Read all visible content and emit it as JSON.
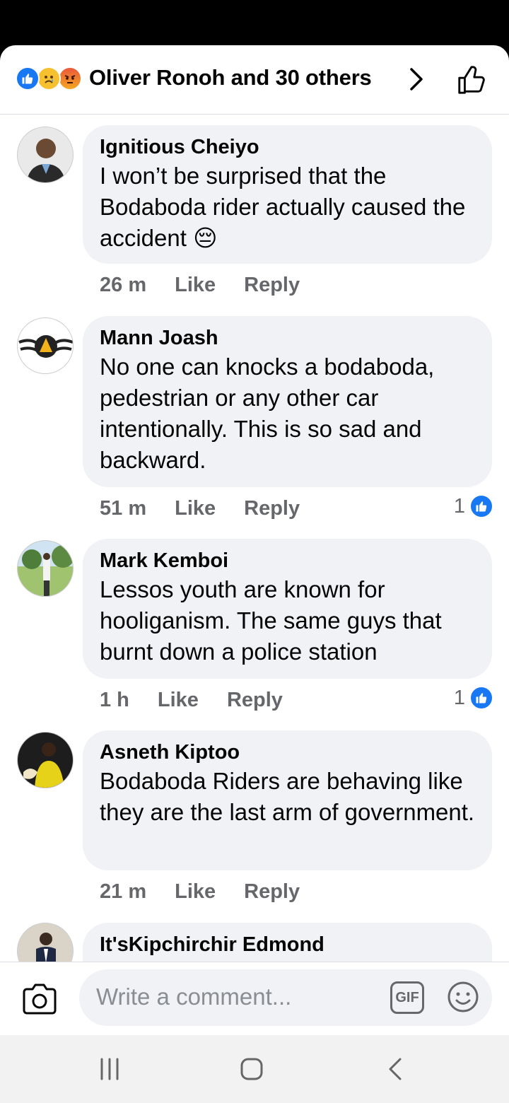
{
  "reactions": {
    "summary": "Oliver Ronoh and 30 others",
    "icons": [
      "like-reaction-icon",
      "sad-reaction-icon",
      "angry-reaction-icon"
    ]
  },
  "comments": [
    {
      "author": "Ignitious Cheiyo",
      "text": "I won’t be surprised that the Bodaboda rider actually caused the accident 😔",
      "time": "26 m",
      "like_label": "Like",
      "reply_label": "Reply",
      "reaction_count": ""
    },
    {
      "author": "Mann Joash",
      "text": "No one can knocks a bodaboda, pedestrian or any other car intentionally. This is so sad and backward.",
      "time": "51 m",
      "like_label": "Like",
      "reply_label": "Reply",
      "reaction_count": "1"
    },
    {
      "author": "Mark Kemboi",
      "text": "Lessos youth are known for hooliganism. The same guys that burnt down a police station",
      "time": "1 h",
      "like_label": "Like",
      "reply_label": "Reply",
      "reaction_count": "1"
    },
    {
      "author": "Asneth Kiptoo",
      "text": "Bodaboda Riders are behaving like they are the last arm of government.",
      "time": "21 m",
      "like_label": "Like",
      "reply_label": "Reply",
      "reaction_count": ""
    },
    {
      "author": "It'sKipchirchir Edmond",
      "text": "",
      "time": "",
      "like_label": "",
      "reply_label": "",
      "reaction_count": ""
    }
  ],
  "composer": {
    "placeholder": "Write a comment...",
    "gif_label": "GIF"
  },
  "colors": {
    "brand_blue": "#1877f2",
    "bubble_bg": "#f0f2f5",
    "secondary_text": "#65676b"
  }
}
